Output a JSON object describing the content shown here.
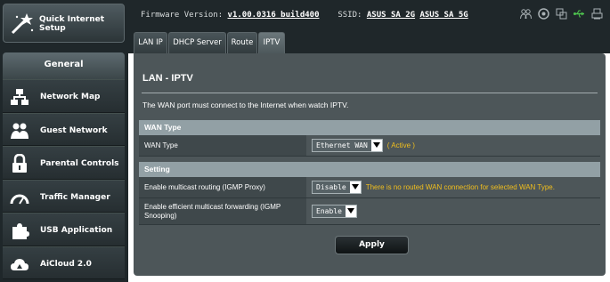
{
  "sidebar": {
    "quick_setup": "Quick Internet Setup",
    "section_title": "General",
    "items": [
      {
        "label": "Network Map",
        "icon": "network-map-icon"
      },
      {
        "label": "Guest Network",
        "icon": "guest-network-icon"
      },
      {
        "label": "Parental Controls",
        "icon": "lock-icon"
      },
      {
        "label": "Traffic Manager",
        "icon": "speedometer-icon"
      },
      {
        "label": "USB Application",
        "icon": "puzzle-icon"
      },
      {
        "label": "AiCloud 2.0",
        "icon": "cloud-icon"
      }
    ]
  },
  "topbar": {
    "firmware_label": "Firmware Version:",
    "firmware_value": "v1.00.0316 build400",
    "ssid_label": "SSID:",
    "ssid_values": [
      "ASUS_SA_2G",
      "ASUS_SA_5G"
    ],
    "icons": [
      "users-icon",
      "globe-icon",
      "copy-icon",
      "usb-icon",
      "printer-icon"
    ]
  },
  "tabs": [
    "LAN IP",
    "DHCP Server",
    "Route",
    "IPTV"
  ],
  "active_tab": "IPTV",
  "page": {
    "title": "LAN - IPTV",
    "description": "The WAN port must connect to the Internet when watch IPTV.",
    "wan_section": "WAN Type",
    "wan_type_label": "WAN Type",
    "wan_type_value": "Ethernet WAN",
    "wan_type_status": "( Active )",
    "setting_section": "Setting",
    "multicast_label": "Enable multicast routing (IGMP Proxy)",
    "multicast_value": "Disable",
    "multicast_note": "There is no routed WAN connection for selected WAN Type.",
    "efficient_label": "Enable efficient multicast forwarding (IGMP Snooping)",
    "efficient_value": "Enable",
    "apply_label": "Apply"
  },
  "colors": {
    "sidebar_bg": "#1f272a",
    "content_bg": "#4d5659",
    "section_header": "#92a0a5",
    "warning_text": "#f2bf1d",
    "usb_icon": "#4ec34e"
  }
}
